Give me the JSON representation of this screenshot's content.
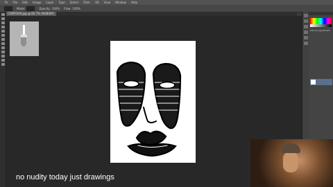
{
  "app": {
    "menus": [
      "Ps",
      "File",
      "Edit",
      "Image",
      "Layer",
      "Type",
      "Select",
      "Filter",
      "3D",
      "View",
      "Window",
      "Help"
    ]
  },
  "options": {
    "mode_label": "Mode:",
    "opacity_label": "Opacity:",
    "opacity_value": "100%",
    "flow_label": "Flow:",
    "flow_value": "100%"
  },
  "document": {
    "tab_title": "CONTOUR.jpg @ 66.7% (RGB/8#)"
  },
  "panels": {
    "adjustments_label": "Add an adjustment"
  },
  "caption": "no nudity today just drawings"
}
